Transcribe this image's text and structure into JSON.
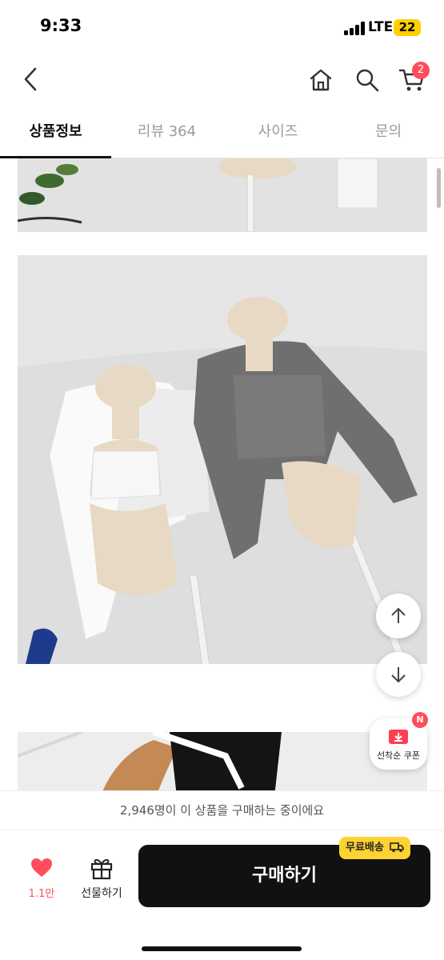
{
  "status_bar": {
    "time": "9:33",
    "network": "LTE",
    "battery": "22"
  },
  "header": {
    "cart_count": "2"
  },
  "tabs": [
    {
      "label": "상품정보",
      "active": true
    },
    {
      "label": "리뷰 364",
      "active": false
    },
    {
      "label": "사이즈",
      "active": false
    },
    {
      "label": "문의",
      "active": false
    }
  ],
  "floating": {
    "coupon_label": "선착순 쿠폰",
    "coupon_badge": "N"
  },
  "notice": {
    "text": "2,946명이 이 상품을 구매하는 중이에요"
  },
  "bottom_bar": {
    "like_count": "1.1만",
    "gift_label": "선물하기",
    "buy_label": "구매하기",
    "free_shipping": "무료배송"
  },
  "colors": {
    "accent": "#ff4d5e",
    "buy_button": "#111111",
    "free_shipping_badge": "#ffd233"
  }
}
